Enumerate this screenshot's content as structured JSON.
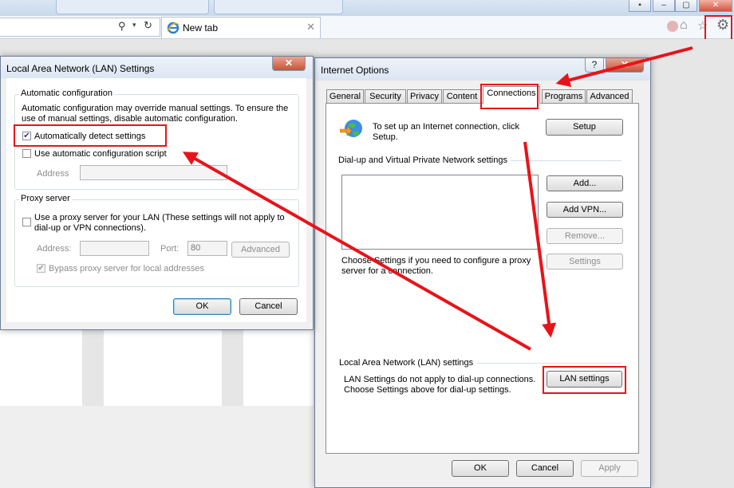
{
  "browser": {
    "tab_title": "New tab",
    "window_buttons": [
      "–",
      "▢",
      "✕"
    ]
  },
  "lan_dialog": {
    "title": "Local Area Network (LAN) Settings",
    "auto_config": {
      "legend": "Automatic configuration",
      "desc_line1": "Automatic configuration may override manual settings.  To ensure the",
      "desc_line2": "use of manual settings, disable automatic configuration.",
      "auto_detect": {
        "label": "Automatically detect settings",
        "checked": true
      },
      "auto_script": {
        "label": "Use automatic configuration script",
        "checked": false
      },
      "address_label": "Address",
      "address_value": ""
    },
    "proxy": {
      "legend": "Proxy server",
      "use_proxy_line1": "Use a proxy server for your LAN (These settings will not apply to",
      "use_proxy_line2": "dial-up or VPN connections).",
      "address_label": "Address:",
      "port_label": "Port:",
      "port_value": "80",
      "advanced_label": "Advanced",
      "bypass_label": "Bypass proxy server for local addresses"
    },
    "ok_label": "OK",
    "cancel_label": "Cancel"
  },
  "inet_dialog": {
    "title": "Internet Options",
    "help_label": "?",
    "close_label": "✕",
    "tabs": [
      "General",
      "Security",
      "Privacy",
      "Content",
      "Connections",
      "Programs",
      "Advanced"
    ],
    "selected_tab": "Connections",
    "setup_text_line1": "To set up an Internet connection, click",
    "setup_text_line2": "Setup.",
    "setup_label": "Setup",
    "dialup_header": "Dial-up and Virtual Private Network settings",
    "add_label": "Add...",
    "add_vpn_label": "Add VPN...",
    "remove_label": "Remove...",
    "settings_label": "Settings",
    "choose_line1": "Choose Settings if you need to configure a proxy",
    "choose_line2": "server for a connection.",
    "lan_header": "Local Area Network (LAN) settings",
    "lan_text_line1": "LAN Settings do not apply to dial-up connections.",
    "lan_text_line2": "Choose Settings above for dial-up settings.",
    "lan_settings_label": "LAN settings",
    "ok_label": "OK",
    "cancel_label": "Cancel",
    "apply_label": "Apply"
  },
  "colors": {
    "annotation_red": "#e8131a",
    "title_bg": "#dbe5f2"
  }
}
